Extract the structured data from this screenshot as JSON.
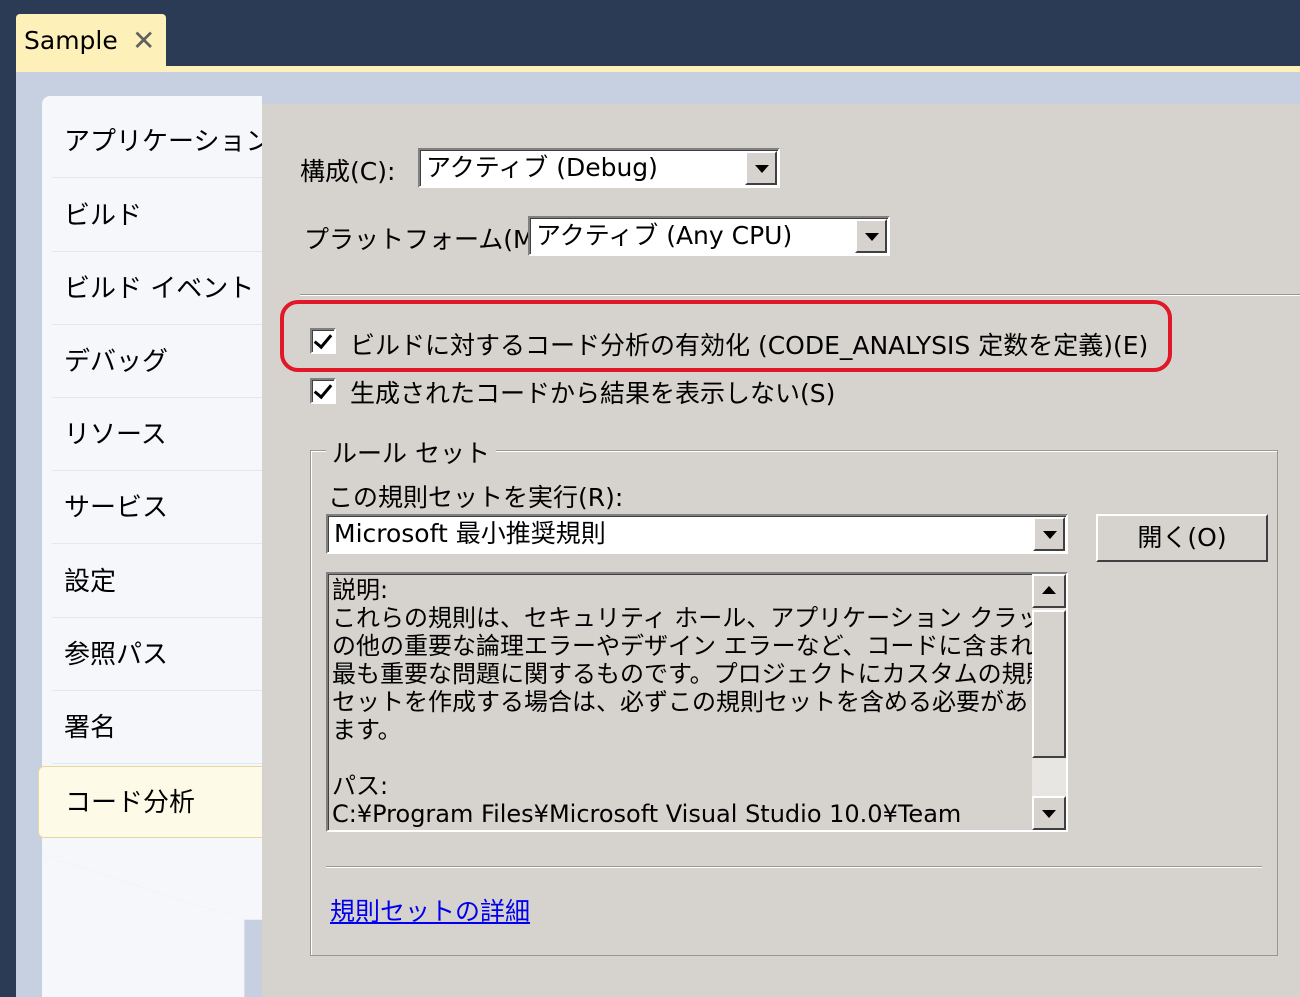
{
  "document_tab": {
    "title": "Sample",
    "close_glyph": "✕"
  },
  "nav": {
    "items": [
      {
        "label": "アプリケーション"
      },
      {
        "label": "ビルド"
      },
      {
        "label": "ビルド イベント"
      },
      {
        "label": "デバッグ"
      },
      {
        "label": "リソース"
      },
      {
        "label": "サービス"
      },
      {
        "label": "設定"
      },
      {
        "label": "参照パス"
      },
      {
        "label": "署名"
      },
      {
        "label": "コード分析"
      }
    ],
    "selected": "コード分析"
  },
  "config": {
    "label": "構成(C):",
    "value": "アクティブ (Debug)"
  },
  "platform": {
    "label": "プラットフォーム(M):",
    "value": "アクティブ (Any CPU)"
  },
  "options": {
    "enable_analysis": {
      "label": "ビルドに対するコード分析の有効化 (CODE_ANALYSIS 定数を定義)(E)",
      "checked": true
    },
    "suppress_generated": {
      "label": "生成されたコードから結果を表示しない(S)",
      "checked": true
    }
  },
  "ruleset": {
    "group_title": "ルール セット",
    "run_label": "この規則セットを実行(R):",
    "selected": "Microsoft 最小推奨規則",
    "open_button": "開く(O)",
    "description": {
      "lines": [
        "説明:",
        "これらの規則は、セキュリティ ホール、アプリケーション クラッシュ、そ",
        "の他の重要な論理エラーやデザイン エラーなど、コードに含まれる",
        "最も重要な問題に関するものです。プロジェクトにカスタムの規則",
        "セットを作成する場合は、必ずこの規則セットを含める必要があり",
        "ます。",
        "",
        "パス:",
        "C:¥Program Files¥Microsoft Visual Studio 10.0¥Team"
      ]
    },
    "details_link": "規則セットの詳細"
  },
  "colors": {
    "title_bar": "#2b3a55",
    "active_tab": "#fdf0b8",
    "dialog_face": "#d6d3ce",
    "highlight_border": "#e01828",
    "link": "#0000ee"
  }
}
